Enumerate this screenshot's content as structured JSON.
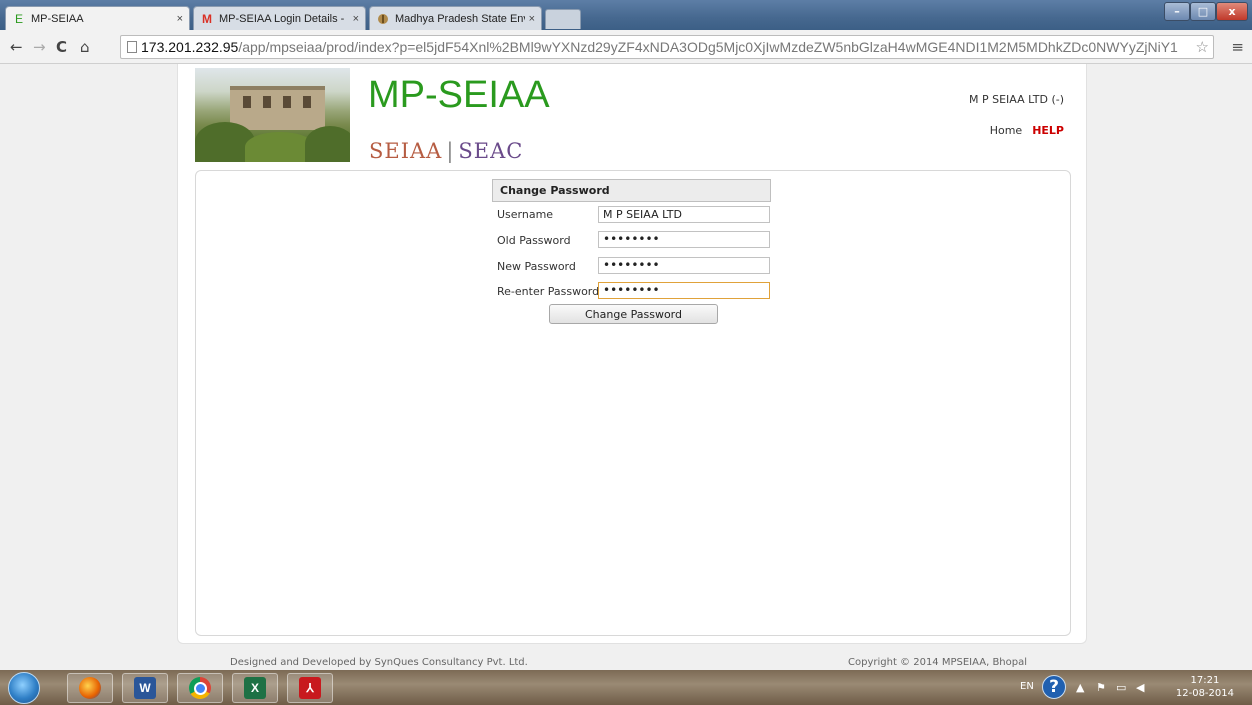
{
  "browser": {
    "tabs": [
      {
        "label": "MP-SEIAA",
        "favicon": "E",
        "active": true
      },
      {
        "label": "MP-SEIAA Login Details -",
        "favicon": "M",
        "active": false
      },
      {
        "label": "Madhya Pradesh State Env",
        "favicon": "seal",
        "active": false
      }
    ],
    "url_host": "173.201.232.95",
    "url_path": "/app/mpseiaa/prod/index?p=el5jdF54Xnl%2BMl9wYXNzd29yZF4xNDA3ODg5Mjc0XjIwMzdeZW5nbGlzaH4wMGE4NDI1M2M5MDhkZDc0NWYyZjNiY1",
    "window_controls": [
      "–",
      "□",
      "x"
    ]
  },
  "header": {
    "title": "MP-SEIAA",
    "subtitle_left": "SEIAA",
    "subtitle_sep": "|",
    "subtitle_right": "SEAC",
    "user": "M P SEIAA LTD  (-)",
    "links": {
      "home": "Home",
      "help": "HELP"
    }
  },
  "form": {
    "heading": "Change Password",
    "fields": [
      {
        "label": "Username",
        "value": "M P SEIAA LTD"
      },
      {
        "label": "Old Password",
        "value": "••••••••"
      },
      {
        "label": "New Password",
        "value": "••••••••"
      },
      {
        "label": "Re-enter Password",
        "value": "••••••••"
      }
    ],
    "submit_label": "Change Password"
  },
  "footer": {
    "left": "Designed and Developed by SynQues Consultancy Pvt. Ltd.",
    "right": "Copyright © 2014 MPSEIAA, Bhopal"
  },
  "taskbar": {
    "lang": "EN",
    "time": "17:21",
    "date": "12-08-2014"
  }
}
